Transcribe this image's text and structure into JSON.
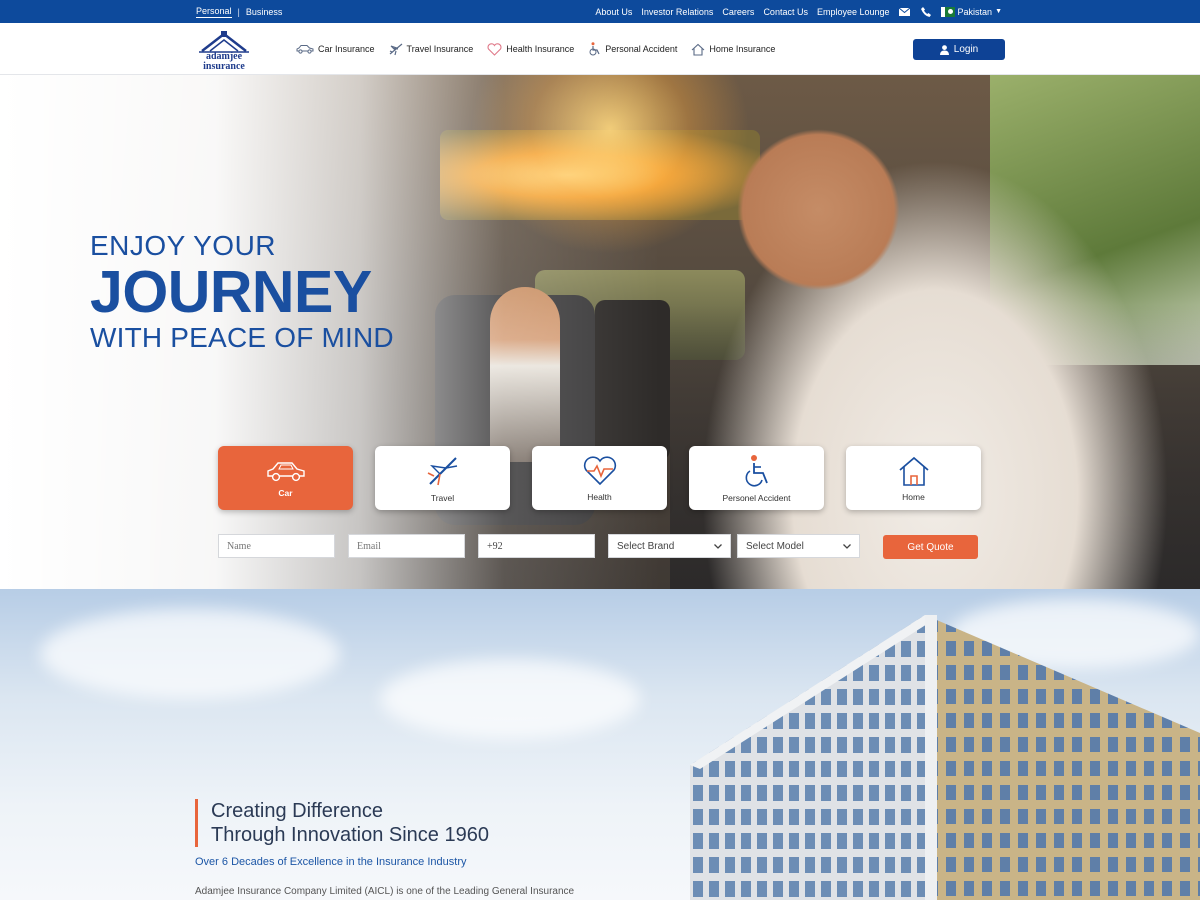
{
  "topbar": {
    "segments": [
      "Personal",
      "Business"
    ],
    "links": [
      "About Us",
      "Investor Relations",
      "Careers",
      "Contact Us",
      "Employee Lounge"
    ],
    "country": "Pakistan",
    "icons": [
      "mail-icon",
      "phone-icon",
      "pakistan-flag-icon"
    ]
  },
  "brand": {
    "logo_text": "adamjee\ninsurance"
  },
  "nav": {
    "items": [
      {
        "label": "Car Insurance",
        "icon": "car-icon"
      },
      {
        "label": "Travel Insurance",
        "icon": "airplane-icon"
      },
      {
        "label": "Health Insurance",
        "icon": "heart-icon"
      },
      {
        "label": "Personal Accident",
        "icon": "wheelchair-icon"
      },
      {
        "label": "Home Insurance",
        "icon": "home-icon"
      }
    ],
    "login_label": "Login"
  },
  "hero": {
    "line1": "ENJOY YOUR",
    "line2": "JOURNEY",
    "line3": "WITH PEACE OF MIND",
    "cards": [
      {
        "label": "Car",
        "icon": "car-icon",
        "active": true
      },
      {
        "label": "Travel",
        "icon": "airplane-icon",
        "active": false
      },
      {
        "label": "Health",
        "icon": "heart-icon",
        "active": false
      },
      {
        "label": "Personel Accident",
        "icon": "wheelchair-icon",
        "active": false
      },
      {
        "label": "Home",
        "icon": "home-icon",
        "active": false
      }
    ],
    "form": {
      "name_placeholder": "Name",
      "email_placeholder": "Email",
      "phone_value": "+92",
      "brand_select": "Select Brand",
      "model_select": "Select Model",
      "submit_label": "Get Quote"
    }
  },
  "about": {
    "title": "Creating Difference\nThrough Innovation Since 1960",
    "subtitle": "Over 6 Decades of Excellence in the Insurance Industry",
    "body": "Adamjee Insurance Company Limited (AICL) is one of the Leading General Insurance"
  },
  "colors": {
    "brand_blue": "#0d4a9c",
    "accent_orange": "#e8653c",
    "headline_blue": "#1a4fa0"
  }
}
